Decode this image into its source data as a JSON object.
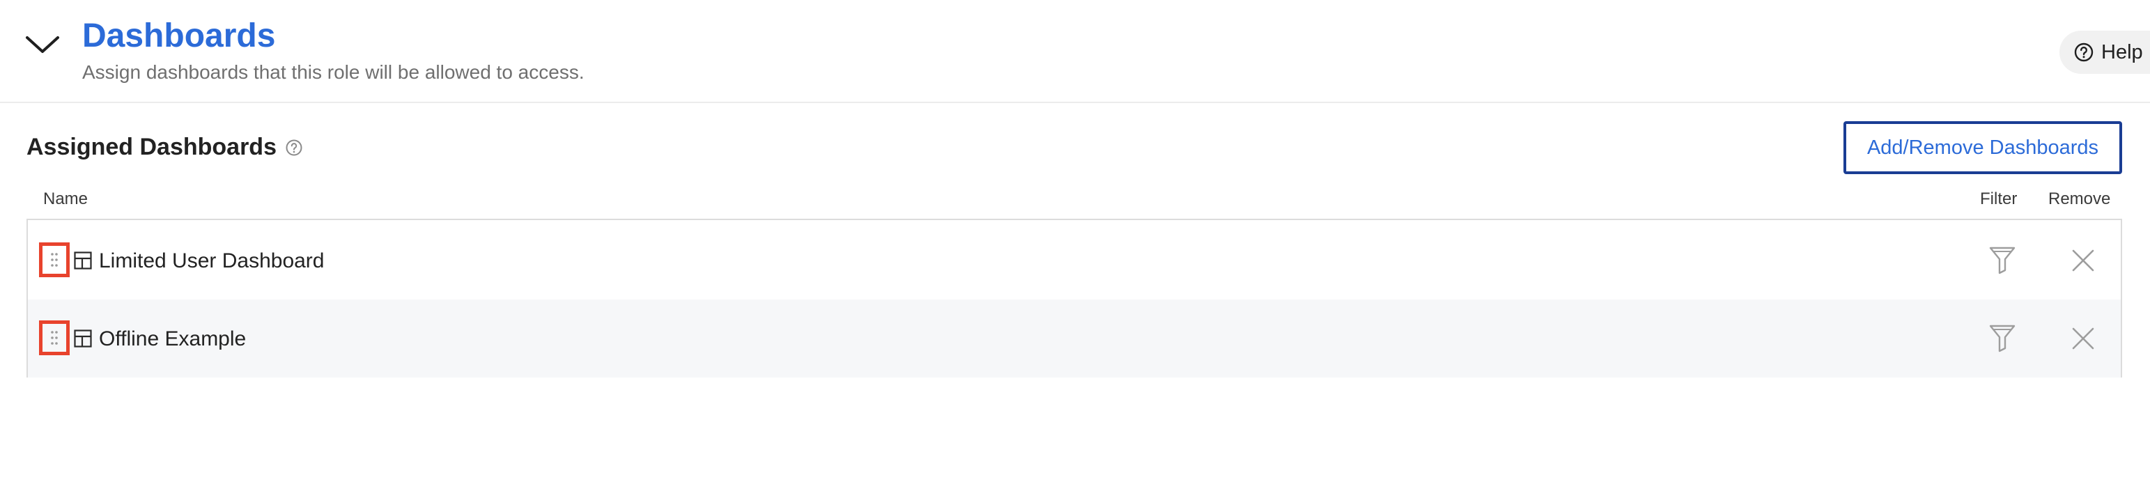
{
  "section": {
    "title": "Dashboards",
    "subtitle": "Assign dashboards that this role will be allowed to access.",
    "collapse_icon": "chevron-down-icon"
  },
  "help": {
    "label": "Help",
    "icon": "question-circle-icon"
  },
  "assigned": {
    "title": "Assigned Dashboards",
    "info_icon": "question-circle-icon",
    "add_remove_label": "Add/Remove Dashboards"
  },
  "table": {
    "columns": {
      "name": "Name",
      "filter": "Filter",
      "remove": "Remove"
    },
    "rows": [
      {
        "name": "Limited User Dashboard",
        "icon": "dashboard-layout-icon"
      },
      {
        "name": "Offline Example",
        "icon": "dashboard-layout-icon"
      }
    ]
  },
  "colors": {
    "accent": "#2c6bd8",
    "button_border": "#1a3d94",
    "drag_highlight": "#e8432d",
    "alt_row": "#f6f7f9"
  }
}
